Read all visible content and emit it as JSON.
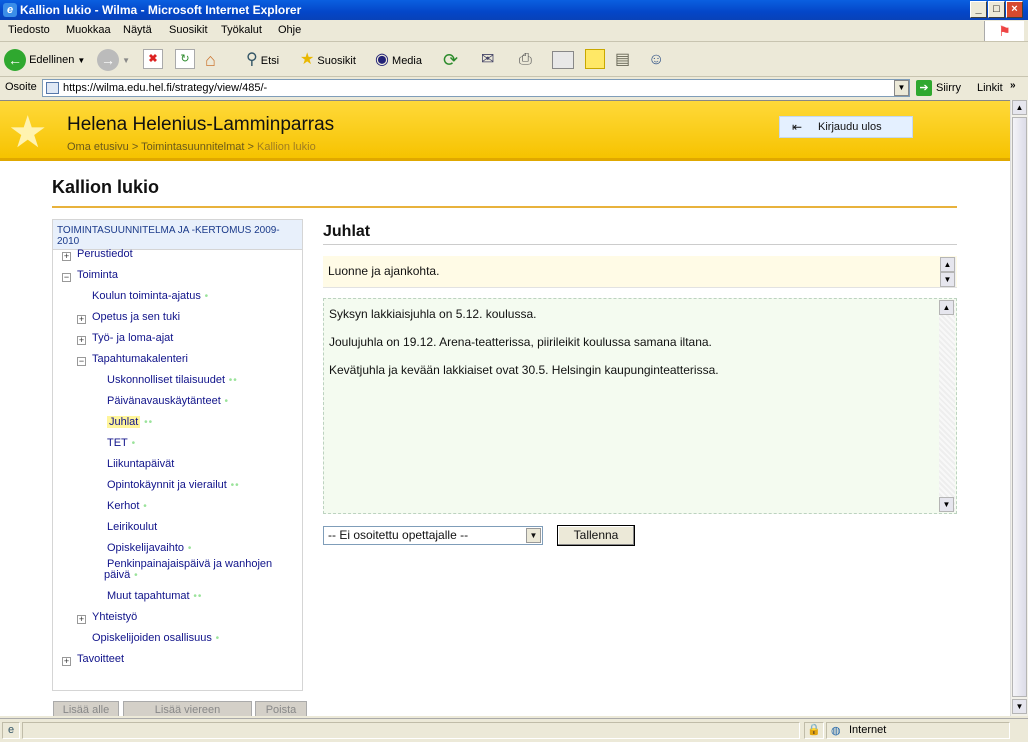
{
  "window": {
    "title": "Kallion lukio - Wilma - Microsoft Internet Explorer",
    "controls": [
      "_",
      "□",
      "×"
    ]
  },
  "menubar": {
    "items": [
      "Tiedosto",
      "Muokkaa",
      "Näytä",
      "Suosikit",
      "Työkalut",
      "Ohje"
    ]
  },
  "toolbar": {
    "back_label": "Edellinen",
    "search_label": "Etsi",
    "favorites_label": "Suosikit",
    "media_label": "Media"
  },
  "addressbar": {
    "label": "Osoite",
    "url": "https://wilma.edu.hel.fi/strategy/view/485/-",
    "go_label": "Siirry",
    "links_label": "Linkit"
  },
  "header": {
    "user_name": "Helena Helenius-Lamminparras",
    "breadcrumb": [
      "Oma etusivu",
      "Toimintasuunnitelmat",
      "Kallion lukio"
    ],
    "logout_label": "Kirjaudu ulos"
  },
  "page": {
    "title": "Kallion lukio"
  },
  "sidebar": {
    "heading": "TOIMINTASUUNNITELMA JA -KERTOMUS 2009-2010",
    "tree": [
      {
        "label": "Perustiedot",
        "toggle": "+",
        "dots": ""
      },
      {
        "label": "Toiminta",
        "toggle": "−",
        "dots": ""
      },
      {
        "label": "Koulun toiminta-ajatus",
        "toggle": "",
        "dots": "•"
      },
      {
        "label": "Opetus ja sen tuki",
        "toggle": "+",
        "dots": ""
      },
      {
        "label": "Työ- ja loma-ajat",
        "toggle": "+",
        "dots": ""
      },
      {
        "label": "Tapahtumakalenteri",
        "toggle": "−",
        "dots": ""
      },
      {
        "label": "Uskonnolliset tilaisuudet",
        "toggle": "",
        "dots": "••"
      },
      {
        "label": "Päivänavauskäytänteet",
        "toggle": "",
        "dots": "•"
      },
      {
        "label": "Juhlat",
        "toggle": "",
        "dots": "••"
      },
      {
        "label": "TET",
        "toggle": "",
        "dots": "•"
      },
      {
        "label": "Liikuntapäivät",
        "toggle": "",
        "dots": ""
      },
      {
        "label": "Opintokäynnit ja vierailut",
        "toggle": "",
        "dots": "••"
      },
      {
        "label": "Kerhot",
        "toggle": "",
        "dots": "•"
      },
      {
        "label": "Leirikoulut",
        "toggle": "",
        "dots": ""
      },
      {
        "label": "Opiskelijavaihto",
        "toggle": "",
        "dots": "•"
      },
      {
        "label": "Penkinpainajaispäivä ja wanhojen",
        "toggle": "",
        "dots": ""
      },
      {
        "label": "päivä",
        "toggle": "",
        "dots": "•"
      },
      {
        "label": "Muut tapahtumat",
        "toggle": "",
        "dots": "••"
      },
      {
        "label": "Yhteistyö",
        "toggle": "+",
        "dots": ""
      },
      {
        "label": "Opiskelijoiden osallisuus",
        "toggle": "",
        "dots": "•"
      },
      {
        "label": "Tavoitteet",
        "toggle": "+",
        "dots": ""
      }
    ],
    "buttons": [
      "Lisää alle",
      "Lisää viereen",
      "Poista"
    ]
  },
  "main": {
    "section_title": "Juhlat",
    "field_description": "Luonne ja ajankohta.",
    "content_lines": [
      "Syksyn lakkiaisjuhla on 5.12. koulussa.",
      "Joulujuhla on 19.12. Arena-teatterissa, piirileikit koulussa samana iltana.",
      "Kevätjuhla ja kevään lakkiaiset ovat 30.5. Helsingin kaupunginteatterissa."
    ],
    "teacher_select_value": "-- Ei osoitettu opettajalle --",
    "save_label": "Tallenna"
  },
  "statusbar": {
    "zone_label": "Internet"
  }
}
